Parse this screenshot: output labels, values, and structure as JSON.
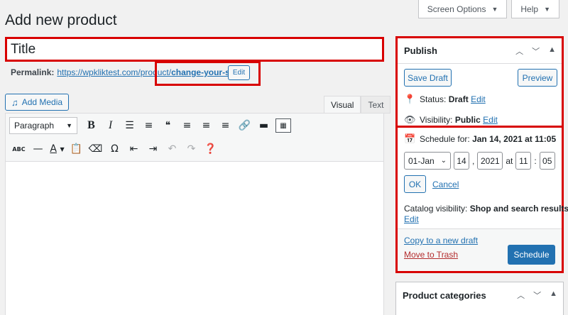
{
  "page": {
    "title": "Add new product"
  },
  "screen_meta": {
    "screen_options": "Screen Options",
    "help": "Help"
  },
  "title_field": {
    "placeholder": "Title"
  },
  "permalink": {
    "label": "Permalink:",
    "base_url": "https://wpkliktest.com/product/",
    "slug": "change-your-slug",
    "trailing": "/",
    "edit_label": "Edit"
  },
  "media": {
    "add_media": "Add Media"
  },
  "editor": {
    "tabs": [
      "Visual",
      "Text"
    ],
    "active_tab": "Visual",
    "format_select": "Paragraph"
  },
  "publish": {
    "title": "Publish",
    "save_draft": "Save Draft",
    "preview": "Preview",
    "status_label": "Status:",
    "status_value": "Draft",
    "status_edit": "Edit",
    "visibility_label": "Visibility:",
    "visibility_value": "Public",
    "visibility_edit": "Edit",
    "schedule_label": "Schedule for:",
    "schedule_value": "Jan 14, 2021 at 11:05",
    "month": "01-Jan",
    "day": "14",
    "year": "2021",
    "at": "at",
    "hour": "11",
    "minute": "05",
    "ok": "OK",
    "cancel": "Cancel",
    "catalog_label": "Catalog visibility:",
    "catalog_value": "Shop and search results",
    "catalog_edit": "Edit",
    "copy_draft": "Copy to a new draft",
    "trash": "Move to Trash",
    "schedule_button": "Schedule"
  },
  "categories": {
    "title": "Product categories"
  },
  "colors": {
    "highlight": "#d80000",
    "primary": "#2271b1",
    "danger": "#b32d2e"
  }
}
